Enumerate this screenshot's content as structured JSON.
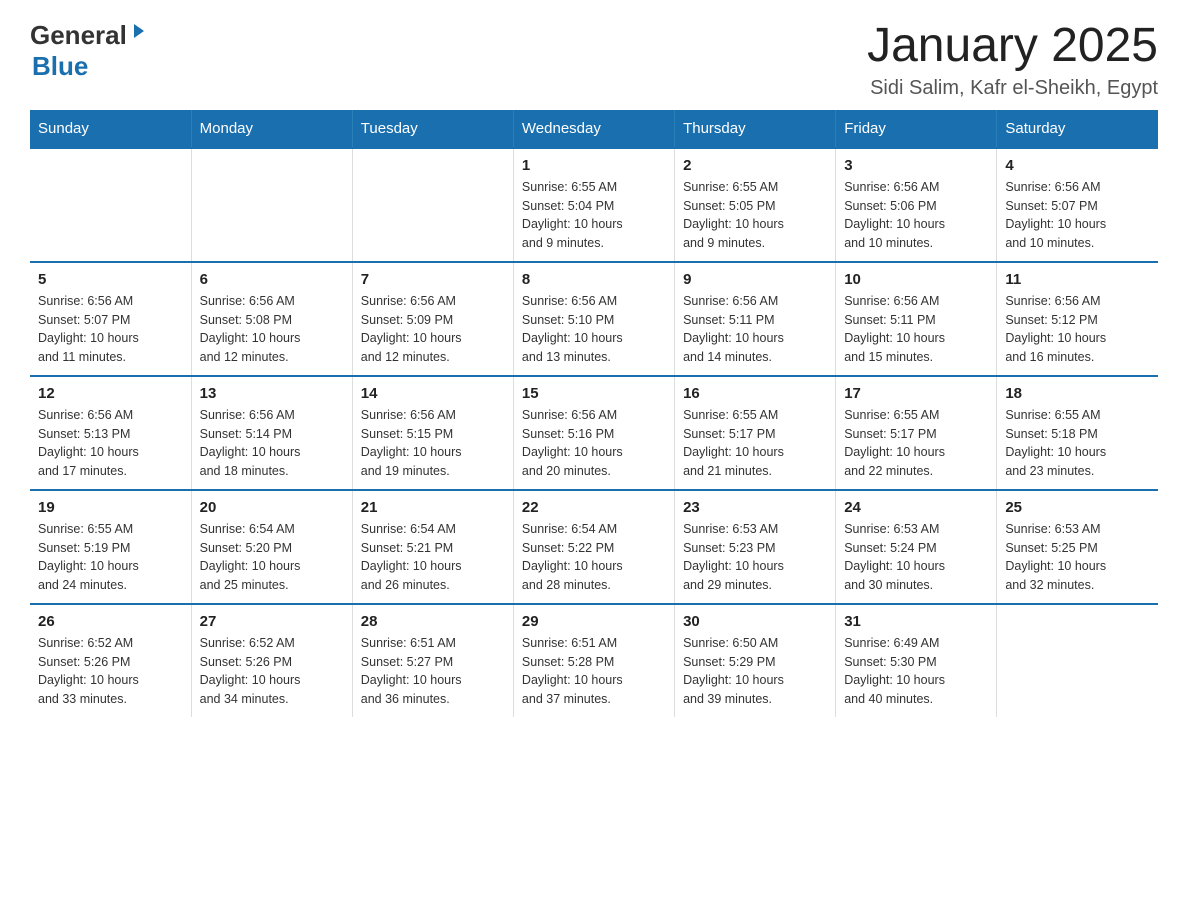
{
  "logo": {
    "general": "General",
    "blue": "Blue",
    "arrow": "▶"
  },
  "title": "January 2025",
  "subtitle": "Sidi Salim, Kafr el-Sheikh, Egypt",
  "days_header": [
    "Sunday",
    "Monday",
    "Tuesday",
    "Wednesday",
    "Thursday",
    "Friday",
    "Saturday"
  ],
  "weeks": [
    [
      {
        "day": "",
        "info": ""
      },
      {
        "day": "",
        "info": ""
      },
      {
        "day": "",
        "info": ""
      },
      {
        "day": "1",
        "info": "Sunrise: 6:55 AM\nSunset: 5:04 PM\nDaylight: 10 hours\nand 9 minutes."
      },
      {
        "day": "2",
        "info": "Sunrise: 6:55 AM\nSunset: 5:05 PM\nDaylight: 10 hours\nand 9 minutes."
      },
      {
        "day": "3",
        "info": "Sunrise: 6:56 AM\nSunset: 5:06 PM\nDaylight: 10 hours\nand 10 minutes."
      },
      {
        "day": "4",
        "info": "Sunrise: 6:56 AM\nSunset: 5:07 PM\nDaylight: 10 hours\nand 10 minutes."
      }
    ],
    [
      {
        "day": "5",
        "info": "Sunrise: 6:56 AM\nSunset: 5:07 PM\nDaylight: 10 hours\nand 11 minutes."
      },
      {
        "day": "6",
        "info": "Sunrise: 6:56 AM\nSunset: 5:08 PM\nDaylight: 10 hours\nand 12 minutes."
      },
      {
        "day": "7",
        "info": "Sunrise: 6:56 AM\nSunset: 5:09 PM\nDaylight: 10 hours\nand 12 minutes."
      },
      {
        "day": "8",
        "info": "Sunrise: 6:56 AM\nSunset: 5:10 PM\nDaylight: 10 hours\nand 13 minutes."
      },
      {
        "day": "9",
        "info": "Sunrise: 6:56 AM\nSunset: 5:11 PM\nDaylight: 10 hours\nand 14 minutes."
      },
      {
        "day": "10",
        "info": "Sunrise: 6:56 AM\nSunset: 5:11 PM\nDaylight: 10 hours\nand 15 minutes."
      },
      {
        "day": "11",
        "info": "Sunrise: 6:56 AM\nSunset: 5:12 PM\nDaylight: 10 hours\nand 16 minutes."
      }
    ],
    [
      {
        "day": "12",
        "info": "Sunrise: 6:56 AM\nSunset: 5:13 PM\nDaylight: 10 hours\nand 17 minutes."
      },
      {
        "day": "13",
        "info": "Sunrise: 6:56 AM\nSunset: 5:14 PM\nDaylight: 10 hours\nand 18 minutes."
      },
      {
        "day": "14",
        "info": "Sunrise: 6:56 AM\nSunset: 5:15 PM\nDaylight: 10 hours\nand 19 minutes."
      },
      {
        "day": "15",
        "info": "Sunrise: 6:56 AM\nSunset: 5:16 PM\nDaylight: 10 hours\nand 20 minutes."
      },
      {
        "day": "16",
        "info": "Sunrise: 6:55 AM\nSunset: 5:17 PM\nDaylight: 10 hours\nand 21 minutes."
      },
      {
        "day": "17",
        "info": "Sunrise: 6:55 AM\nSunset: 5:17 PM\nDaylight: 10 hours\nand 22 minutes."
      },
      {
        "day": "18",
        "info": "Sunrise: 6:55 AM\nSunset: 5:18 PM\nDaylight: 10 hours\nand 23 minutes."
      }
    ],
    [
      {
        "day": "19",
        "info": "Sunrise: 6:55 AM\nSunset: 5:19 PM\nDaylight: 10 hours\nand 24 minutes."
      },
      {
        "day": "20",
        "info": "Sunrise: 6:54 AM\nSunset: 5:20 PM\nDaylight: 10 hours\nand 25 minutes."
      },
      {
        "day": "21",
        "info": "Sunrise: 6:54 AM\nSunset: 5:21 PM\nDaylight: 10 hours\nand 26 minutes."
      },
      {
        "day": "22",
        "info": "Sunrise: 6:54 AM\nSunset: 5:22 PM\nDaylight: 10 hours\nand 28 minutes."
      },
      {
        "day": "23",
        "info": "Sunrise: 6:53 AM\nSunset: 5:23 PM\nDaylight: 10 hours\nand 29 minutes."
      },
      {
        "day": "24",
        "info": "Sunrise: 6:53 AM\nSunset: 5:24 PM\nDaylight: 10 hours\nand 30 minutes."
      },
      {
        "day": "25",
        "info": "Sunrise: 6:53 AM\nSunset: 5:25 PM\nDaylight: 10 hours\nand 32 minutes."
      }
    ],
    [
      {
        "day": "26",
        "info": "Sunrise: 6:52 AM\nSunset: 5:26 PM\nDaylight: 10 hours\nand 33 minutes."
      },
      {
        "day": "27",
        "info": "Sunrise: 6:52 AM\nSunset: 5:26 PM\nDaylight: 10 hours\nand 34 minutes."
      },
      {
        "day": "28",
        "info": "Sunrise: 6:51 AM\nSunset: 5:27 PM\nDaylight: 10 hours\nand 36 minutes."
      },
      {
        "day": "29",
        "info": "Sunrise: 6:51 AM\nSunset: 5:28 PM\nDaylight: 10 hours\nand 37 minutes."
      },
      {
        "day": "30",
        "info": "Sunrise: 6:50 AM\nSunset: 5:29 PM\nDaylight: 10 hours\nand 39 minutes."
      },
      {
        "day": "31",
        "info": "Sunrise: 6:49 AM\nSunset: 5:30 PM\nDaylight: 10 hours\nand 40 minutes."
      },
      {
        "day": "",
        "info": ""
      }
    ]
  ]
}
